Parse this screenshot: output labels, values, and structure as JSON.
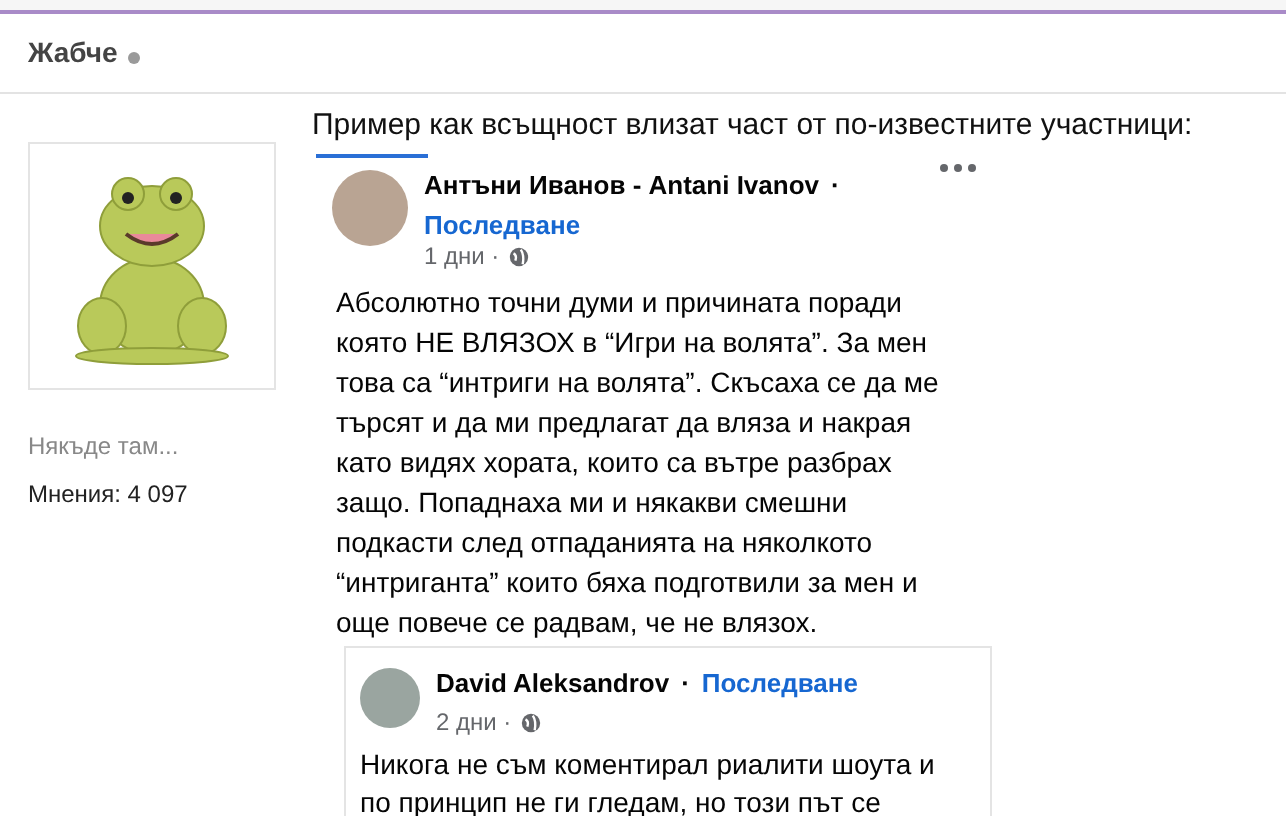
{
  "topic_header": {
    "author": "Жабче",
    "online": false
  },
  "user_panel": {
    "location": "Някъде там...",
    "posts": "Мнения: 4 097"
  },
  "post": {
    "text": "Пример как всъщност влизат част от по-известните участници:",
    "embedded_post": {
      "author": "Антъни Иванов - Antani Ivanov",
      "separator": "·",
      "follow": "Последване",
      "time": "1 дни ·",
      "body": "Абсолютно точни думи и причината поради която НЕ ВЛЯЗОХ в “Игри на волята”. За мен това са “интриги на волята”. Скъсаха се да ме търсят и да ми предлагат да вляза и накрая като видях хората, които са вътре разбрах защо. Попаднаха ми и някакви смешни подкасти след отпаданията на няколкото “интриганта” които бяха подготвили за мен и още повече се радвам, че не влязох.",
      "comment": {
        "author": "David Aleksandrov",
        "separator": "·",
        "follow": "Последване",
        "time": "2 дни ·",
        "body": "Никога не съм коментирал риалити шоута и по принцип не ги гледам, но този път се"
      }
    }
  }
}
